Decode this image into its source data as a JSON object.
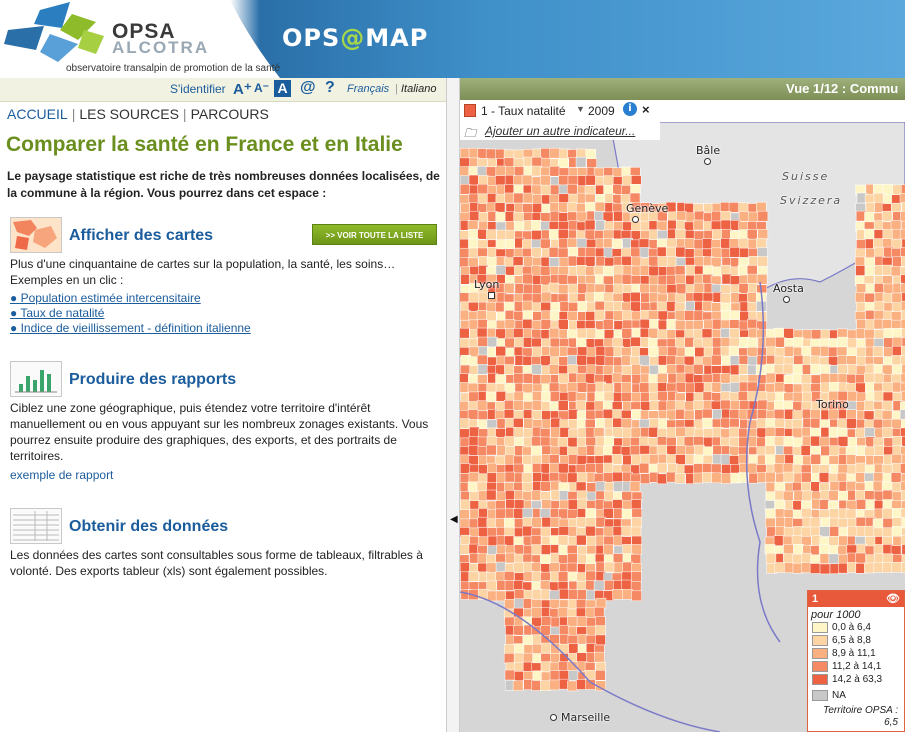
{
  "header": {
    "logo_opsa": "OPSA",
    "logo_alcotra": "ALCOTRA",
    "logo_tagline": "observatoire transalpin de promotion de la santé",
    "app_logo_prefix": "OPS",
    "app_logo_at": "@",
    "app_logo_suffix": "MAP"
  },
  "toolbar": {
    "login": "S'identifier",
    "font_increase": "A⁺",
    "font_decrease": "A⁻",
    "font_reset": "A",
    "contact": "@",
    "help": "?",
    "lang_fr": "Français",
    "lang_sep": "|",
    "lang_it": "Italiano"
  },
  "nav": {
    "items": [
      "ACCUEIL",
      "LES SOURCES",
      "PARCOURS"
    ],
    "separator": "|"
  },
  "page": {
    "title": "Comparer la santé en France et en Italie",
    "intro": "Le paysage statistique est riche de très nombreuses données localisées, de la commune à la région. Vous pourrez dans cet espace :"
  },
  "sections": {
    "cartes": {
      "title": "Afficher des cartes",
      "button": ">> VOIR TOUTE LA LISTE",
      "text": "Plus d'une cinquantaine de cartes sur la population, la santé, les soins… Exemples en un clic :",
      "links": [
        "● Population estimée intercensitaire",
        "● Taux de natalité",
        "● Indice de vieillissement - définition italienne"
      ]
    },
    "rapports": {
      "title": "Produire des rapports",
      "text": "Ciblez une zone géographique, puis étendez votre territoire d'intérêt manuellement ou en vous appuyant sur les nombreux zonages existants. Vous pourrez ensuite produire des graphiques, des exports, et des portraits de territoires.",
      "link": "exemple de rapport"
    },
    "donnees": {
      "title": "Obtenir des données",
      "text": "Les données des cartes sont consultables sous forme de tableaux, filtrables à volonté. Des exports tableur (xls) sont également possibles."
    }
  },
  "map": {
    "view_label": "Vue 1/12 : Commu",
    "layer_label": "1 - Taux natalité",
    "layer_year": "2009",
    "add_indicator": "Ajouter un autre indicateur...",
    "places": [
      "Bâle",
      "Genève",
      "Suisse",
      "Svizzera",
      "Lyon",
      "Aosta",
      "Torino",
      "Marseille"
    ],
    "colors": {
      "c1": "#fff6c8",
      "c2": "#fdd4a4",
      "c3": "#fbb082",
      "c4": "#f58964",
      "c5": "#ee6244",
      "na": "#c8c8c8",
      "accent": "#e8583a",
      "header_green": "#8fa066",
      "link_blue": "#1b5c9c",
      "title_green": "#6b8f1e"
    }
  },
  "legend": {
    "layer_num": "1",
    "unit": "pour 1000",
    "classes": [
      "0,0 à 6,4",
      "6,5 à 8,8",
      "8,9 à 11,1",
      "11,2 à 14,1",
      "14,2 à 63,3"
    ],
    "na": "NA",
    "territory_label": "Territoire OPSA :",
    "territory_value": "6,5"
  }
}
